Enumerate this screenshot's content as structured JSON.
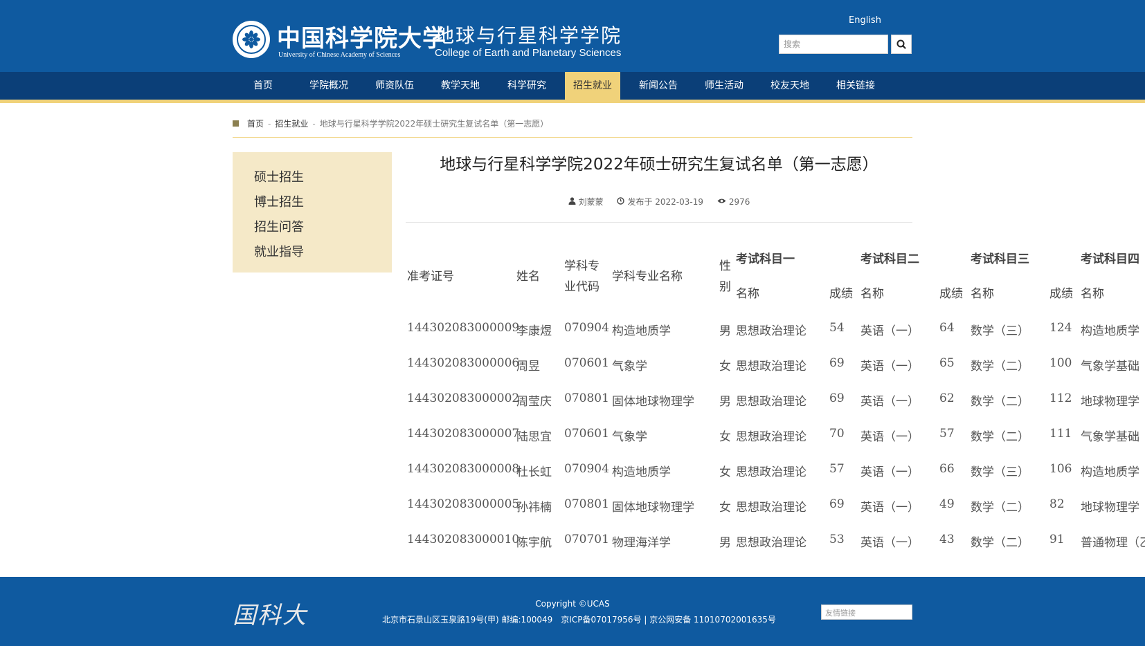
{
  "header": {
    "university_cn": "中国科学院大学",
    "university_en": "University of Chinese Academy of Sciences",
    "college_cn": "地球与行星科学学院",
    "college_en": "College of Earth and Planetary Sciences",
    "language_link": "English",
    "search_placeholder": "搜索"
  },
  "nav": {
    "items": [
      "首页",
      "学院概况",
      "师资队伍",
      "教学天地",
      "科学研究",
      "招生就业",
      "新闻公告",
      "师生活动",
      "校友天地",
      "相关链接"
    ],
    "active_index": 5
  },
  "breadcrumb": {
    "home": "首页",
    "section": "招生就业",
    "current": "地球与行星科学学院2022年硕士研究生复试名单（第一志愿）"
  },
  "sidebar": {
    "items": [
      "硕士招生",
      "博士招生",
      "招生问答",
      "就业指导"
    ]
  },
  "article": {
    "title": "地球与行星科学学院2022年硕士研究生复试名单（第一志愿）",
    "author": "刘蒙蒙",
    "published": "发布于 2022-03-19",
    "views": "2976"
  },
  "table": {
    "headers": {
      "exam_id": "准考证号",
      "name": "姓名",
      "major_code_l1": "学科专",
      "major_code_l2": "业代码",
      "major_name": "学科专业名称",
      "gender_l1": "性",
      "gender_l2": "别",
      "subject1": "考试科目一",
      "subject2": "考试科目二",
      "subject3": "考试科目三",
      "subject4": "考试科目四",
      "sub_name": "名称",
      "sub_score": "成绩"
    },
    "rows": [
      {
        "id": "144302083000009",
        "name": "李康煜",
        "code": "070904",
        "major": "构造地质学",
        "gender": "男",
        "s1": "思想政治理论",
        "sc1": "54",
        "s2": "英语（一）",
        "sc2": "64",
        "s3": "数学（三）",
        "sc3": "124",
        "s4": "构造地质学"
      },
      {
        "id": "144302083000006",
        "name": "周昱",
        "code": "070601",
        "major": "气象学",
        "gender": "女",
        "s1": "思想政治理论",
        "sc1": "69",
        "s2": "英语（一）",
        "sc2": "65",
        "s3": "数学（二）",
        "sc3": "100",
        "s4": "气象学基础"
      },
      {
        "id": "144302083000002",
        "name": "周莹庆",
        "code": "070801",
        "major": "固体地球物理学",
        "gender": "男",
        "s1": "思想政治理论",
        "sc1": "69",
        "s2": "英语（一）",
        "sc2": "62",
        "s3": "数学（二）",
        "sc3": "112",
        "s4": "地球物理学"
      },
      {
        "id": "144302083000007",
        "name": "陆思宜",
        "code": "070601",
        "major": "气象学",
        "gender": "女",
        "s1": "思想政治理论",
        "sc1": "70",
        "s2": "英语（一）",
        "sc2": "57",
        "s3": "数学（二）",
        "sc3": "111",
        "s4": "气象学基础"
      },
      {
        "id": "144302083000008",
        "name": "杜长虹",
        "code": "070904",
        "major": "构造地质学",
        "gender": "女",
        "s1": "思想政治理论",
        "sc1": "57",
        "s2": "英语（一）",
        "sc2": "66",
        "s3": "数学（三）",
        "sc3": "106",
        "s4": "构造地质学"
      },
      {
        "id": "144302083000005",
        "name": "孙祎楠",
        "code": "070801",
        "major": "固体地球物理学",
        "gender": "女",
        "s1": "思想政治理论",
        "sc1": "69",
        "s2": "英语（一）",
        "sc2": "49",
        "s3": "数学（二）",
        "sc3": "82",
        "s4": "地球物理学"
      },
      {
        "id": "144302083000010",
        "name": "陈宇航",
        "code": "070701",
        "major": "物理海洋学",
        "gender": "男",
        "s1": "思想政治理论",
        "sc1": "53",
        "s2": "英语（一）",
        "sc2": "43",
        "s3": "数学（二）",
        "sc3": "91",
        "s4": "普通物理（乙"
      }
    ]
  },
  "footer": {
    "logo_text": "国科大",
    "copyright": "Copyright ©UCAS",
    "address": "北京市石景山区玉泉路19号(甲) 邮编:100049　京ICP备07017956号 | 京公网安备 110107020016­35号",
    "friendly_links_placeholder": "友情链接"
  },
  "colors": {
    "header_blue": "#0f5aa0",
    "nav_dark_blue": "#0b3f78",
    "accent_gold": "#f0d27a",
    "sidebar_bg": "#f5e9c8"
  }
}
